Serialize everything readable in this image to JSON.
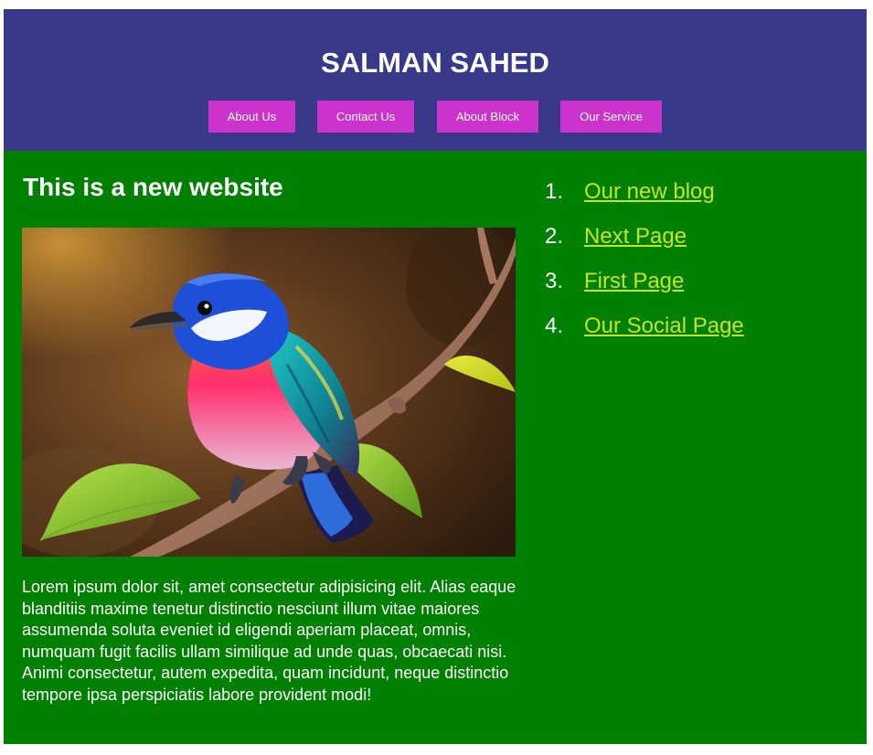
{
  "header": {
    "title": "SALMAN SAHED",
    "nav": [
      {
        "label": "About Us"
      },
      {
        "label": "Contact Us"
      },
      {
        "label": "About Block"
      },
      {
        "label": "Our Service"
      }
    ]
  },
  "main": {
    "heading": "This is a new website",
    "paragraph": "Lorem ipsum dolor sit, amet consectetur adipisicing elit. Alias eaque blanditiis maxime tenetur distinctio nesciunt illum vitae maiores assumenda soluta eveniet id eligendi aperiam placeat, omnis, numquam fugit facilis ullam similique ad unde quas, obcaecati nisi. Animi consectetur, autem expedita, quam incidunt, neque distinctio tempore ipsa perspiciatis labore provident modi!"
  },
  "links": [
    {
      "number": "1.",
      "label": "Our new blog"
    },
    {
      "number": "2.",
      "label": "Next Page"
    },
    {
      "number": "3.",
      "label": "First Page"
    },
    {
      "number": "4.",
      "label": "Our Social Page"
    }
  ],
  "colors": {
    "header_bg": "#39398c",
    "main_bg": "#008000",
    "nav_button_bg": "#cc33cc",
    "link_color": "#c6e31f"
  }
}
